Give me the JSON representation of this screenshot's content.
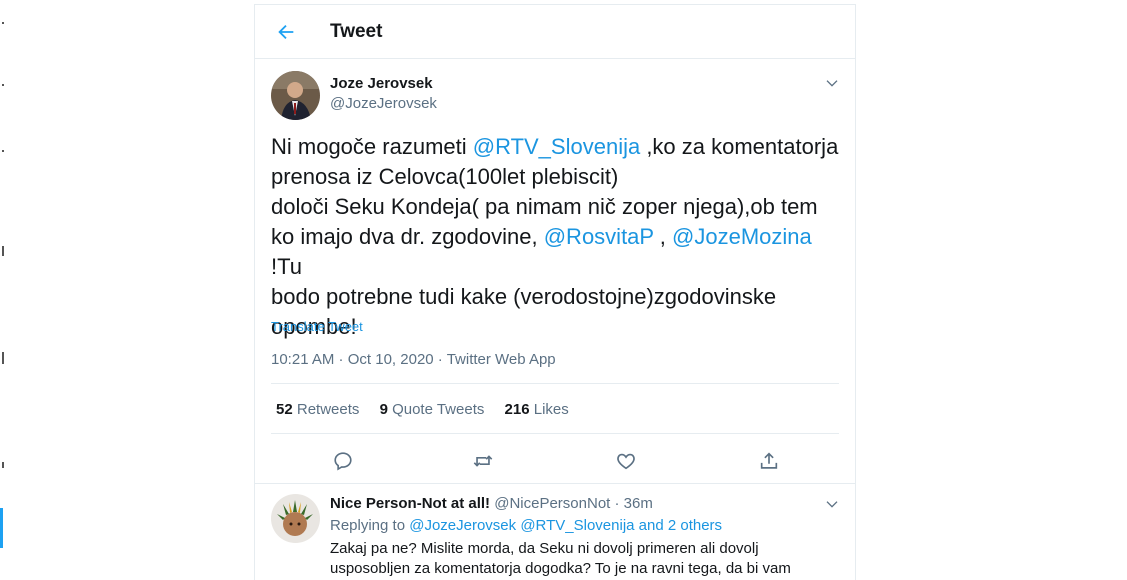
{
  "header": {
    "title": "Tweet"
  },
  "tweet": {
    "author_name": "Joze Jerovsek",
    "author_handle": "@JozeJerovsek",
    "line1_a": "Ni mogoče razumeti ",
    "line1_mention": "@RTV_Slovenija",
    "line1_b": " ,ko za komentatorja",
    "line2": "prenosa iz Celovca(100let plebiscit)",
    "line3": "določi Seku Kondeja( pa nimam nič zoper njega),ob tem",
    "line4_a": "ko imajo dva dr. zgodovine, ",
    "line4_mention1": "@RosvitaP",
    "line4_mid": " , ",
    "line4_mention2": "@JozeMozina",
    "line4_b": " !Tu",
    "line5": "bodo potrebne tudi kake (verodostojne)zgodovinske",
    "line6": "opombe!",
    "translate": "Translate Tweet",
    "time": "10:21 AM",
    "dot": " · ",
    "date": "Oct 10, 2020",
    "source": "Twitter Web App"
  },
  "stats": {
    "retweets_count": "52",
    "retweets_label": "Retweets",
    "quotes_count": "9",
    "quotes_label": "Quote Tweets",
    "likes_count": "216",
    "likes_label": "Likes"
  },
  "reply": {
    "author_name": "Nice Person-Not at all!",
    "author_handle": "@NicePersonNot",
    "dot": " · ",
    "time": "36m",
    "replying_prefix": "Replying to ",
    "replying_targets": "@JozeJerovsek @RTV_Slovenija and 2 others",
    "text_line1": "Zakaj pa ne? Mislite morda, da Seku ni dovolj primeren ali dovolj",
    "text_line2": "usposobljen za komentatorja dogodka? To je na ravni tega, da bi vam"
  },
  "icons": {
    "back": "back-arrow-icon",
    "caret": "chevron-down-icon",
    "reply": "reply-icon",
    "retweet": "retweet-icon",
    "like": "like-icon",
    "share": "share-icon"
  },
  "colors": {
    "accent": "#1da1f2",
    "link": "#1b95e0",
    "muted": "#5b7083",
    "text": "#14171a",
    "border": "#e6ecf0"
  }
}
